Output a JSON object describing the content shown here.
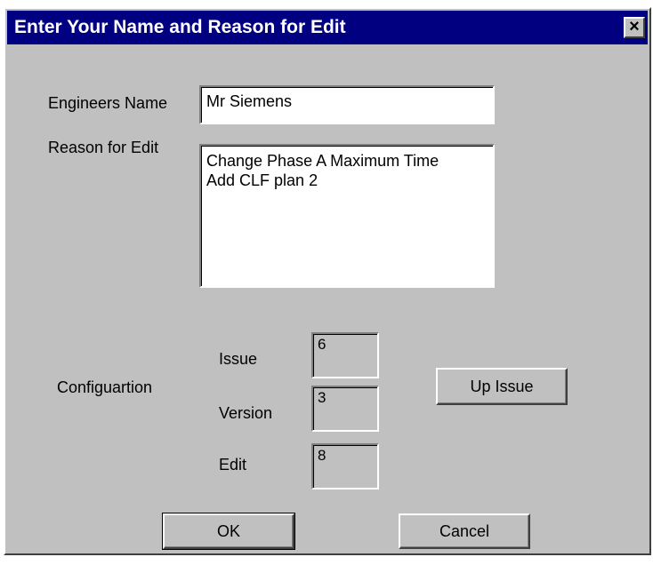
{
  "dialog": {
    "title": "Enter Your Name and Reason for Edit",
    "close_label": "×"
  },
  "form": {
    "engineer_label": "Engineers Name",
    "engineer_value": "Mr Siemens",
    "reason_label": "Reason for Edit",
    "reason_value": "Change Phase A Maximum Time\nAdd CLF plan 2"
  },
  "configuration": {
    "label": "Configuartion",
    "issue_label": "Issue",
    "issue_value": "6",
    "version_label": "Version",
    "version_value": "3",
    "edit_label": "Edit",
    "edit_value": "8",
    "up_issue_label": "Up Issue"
  },
  "buttons": {
    "ok_label": "OK",
    "cancel_label": "Cancel"
  }
}
